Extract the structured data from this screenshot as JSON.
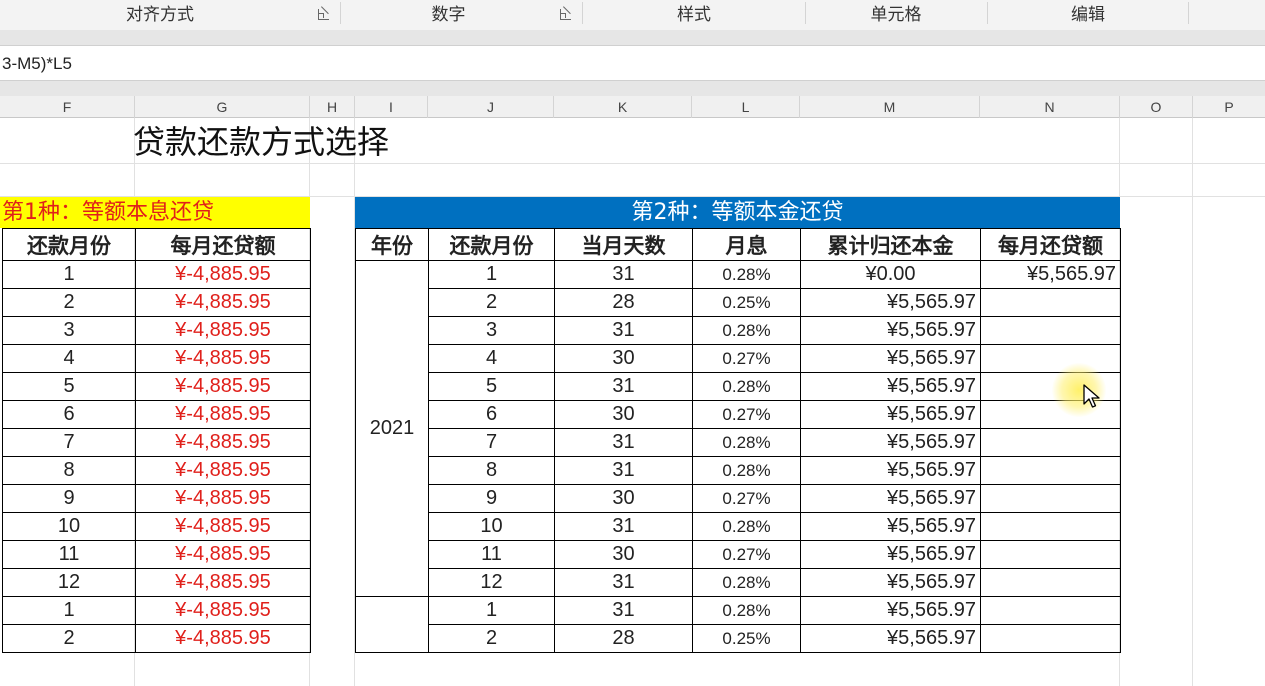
{
  "ribbon": {
    "groups": [
      {
        "label": "对齐方式"
      },
      {
        "label": "数字"
      },
      {
        "label": "样式"
      },
      {
        "label": "单元格"
      },
      {
        "label": "编辑"
      }
    ]
  },
  "formula_bar": {
    "text": "3-M5)*L5"
  },
  "columns": [
    "F",
    "G",
    "H",
    "I",
    "J",
    "K",
    "L",
    "M",
    "N",
    "O",
    "P"
  ],
  "title": "贷款还款方式选择",
  "table1": {
    "banner": "第1种：等额本息还贷",
    "headers": [
      "还款月份",
      "每月还贷额"
    ],
    "rows": [
      {
        "month": "1",
        "amount": "¥-4,885.95"
      },
      {
        "month": "2",
        "amount": "¥-4,885.95"
      },
      {
        "month": "3",
        "amount": "¥-4,885.95"
      },
      {
        "month": "4",
        "amount": "¥-4,885.95"
      },
      {
        "month": "5",
        "amount": "¥-4,885.95"
      },
      {
        "month": "6",
        "amount": "¥-4,885.95"
      },
      {
        "month": "7",
        "amount": "¥-4,885.95"
      },
      {
        "month": "8",
        "amount": "¥-4,885.95"
      },
      {
        "month": "9",
        "amount": "¥-4,885.95"
      },
      {
        "month": "10",
        "amount": "¥-4,885.95"
      },
      {
        "month": "11",
        "amount": "¥-4,885.95"
      },
      {
        "month": "12",
        "amount": "¥-4,885.95"
      },
      {
        "month": "1",
        "amount": "¥-4,885.95"
      },
      {
        "month": "2",
        "amount": "¥-4,885.95"
      }
    ]
  },
  "table2": {
    "banner": "第2种：等额本金还贷",
    "headers": [
      "年份",
      "还款月份",
      "当月天数",
      "月息",
      "累计归还本金",
      "每月还贷额"
    ],
    "year": "2021",
    "rows": [
      {
        "month": "1",
        "days": "31",
        "rate": "0.28%",
        "principal": "¥0.00",
        "payment": "¥5,565.97"
      },
      {
        "month": "2",
        "days": "28",
        "rate": "0.25%",
        "principal": "¥5,565.97",
        "payment": ""
      },
      {
        "month": "3",
        "days": "31",
        "rate": "0.28%",
        "principal": "¥5,565.97",
        "payment": ""
      },
      {
        "month": "4",
        "days": "30",
        "rate": "0.27%",
        "principal": "¥5,565.97",
        "payment": ""
      },
      {
        "month": "5",
        "days": "31",
        "rate": "0.28%",
        "principal": "¥5,565.97",
        "payment": ""
      },
      {
        "month": "6",
        "days": "30",
        "rate": "0.27%",
        "principal": "¥5,565.97",
        "payment": ""
      },
      {
        "month": "7",
        "days": "31",
        "rate": "0.28%",
        "principal": "¥5,565.97",
        "payment": ""
      },
      {
        "month": "8",
        "days": "31",
        "rate": "0.28%",
        "principal": "¥5,565.97",
        "payment": ""
      },
      {
        "month": "9",
        "days": "30",
        "rate": "0.27%",
        "principal": "¥5,565.97",
        "payment": ""
      },
      {
        "month": "10",
        "days": "31",
        "rate": "0.28%",
        "principal": "¥5,565.97",
        "payment": ""
      },
      {
        "month": "11",
        "days": "30",
        "rate": "0.27%",
        "principal": "¥5,565.97",
        "payment": ""
      },
      {
        "month": "12",
        "days": "31",
        "rate": "0.28%",
        "principal": "¥5,565.97",
        "payment": ""
      },
      {
        "month": "1",
        "days": "31",
        "rate": "0.28%",
        "principal": "¥5,565.97",
        "payment": ""
      },
      {
        "month": "2",
        "days": "28",
        "rate": "0.25%",
        "principal": "¥5,565.97",
        "payment": ""
      }
    ]
  },
  "colors": {
    "banner1_bg": "#ffff00",
    "banner1_text": "#e0201b",
    "banner2_bg": "#0070c0",
    "banner2_text": "#ffffff",
    "negative_amount": "#e0201b",
    "cursor_highlight": "#ffee50"
  }
}
